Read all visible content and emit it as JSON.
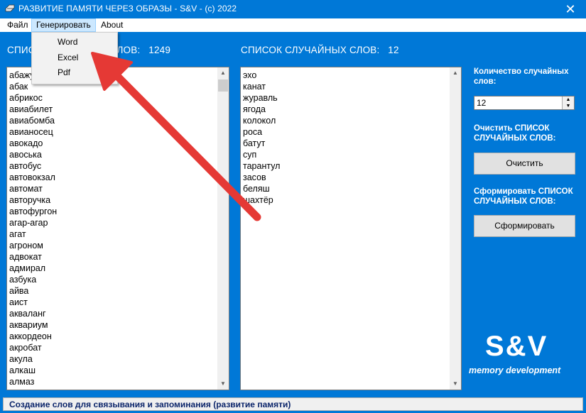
{
  "window": {
    "title": "РАЗВИТИЕ ПАМЯТИ ЧЕРЕЗ ОБРАЗЫ - S&V -  (c) 2022",
    "close_glyph": "✕"
  },
  "menu": {
    "items": [
      {
        "label": "Файл"
      },
      {
        "label": "Генерировать"
      },
      {
        "label": "About"
      }
    ],
    "dropdown": [
      "Word",
      "Excel",
      "Pdf"
    ]
  },
  "left_panel": {
    "header_label": "СПИСОК ИСХОДНЫХ СЛОВ:",
    "count": "1249",
    "items": [
      "абажур",
      "абак",
      "абрикос",
      "авиабилет",
      "авиабомба",
      "авианосец",
      "авокадо",
      "авоська",
      "автобус",
      "автовокзал",
      "автомат",
      "авторучка",
      "автофургон",
      "агар-агар",
      "агат",
      "агроном",
      "адвокат",
      "адмирал",
      "азбука",
      "айва",
      "аист",
      "акваланг",
      "аквариум",
      "аккордеон",
      "акробат",
      "акула",
      "алкаш",
      "алмаз"
    ]
  },
  "middle_panel": {
    "header_label": "СПИСОК СЛУЧАЙНЫХ СЛОВ:",
    "count": "12",
    "items": [
      "эхо",
      "канат",
      "журавль",
      "ягода",
      "колокол",
      "роса",
      "батут",
      "суп",
      "тарантул",
      "засов",
      "беляш",
      "шахтёр"
    ]
  },
  "controls": {
    "count_label": "Количество случайных слов:",
    "count_value": "12",
    "clear_label": "Очистить СПИСОК СЛУЧАЙНЫХ СЛОВ:",
    "clear_button": "Очистить",
    "generate_label": "Сформировать СПИСОК СЛУЧАЙНЫХ СЛОВ:",
    "generate_button": "Сформировать"
  },
  "logo": {
    "main": "S&V",
    "sub": "memory development"
  },
  "status": {
    "text": "Создание слов для связывания и запоминания (развитие памяти)"
  },
  "colors": {
    "background": "#0078d7",
    "arrow": "#e53935",
    "menu_highlight": "#cce8ff"
  }
}
